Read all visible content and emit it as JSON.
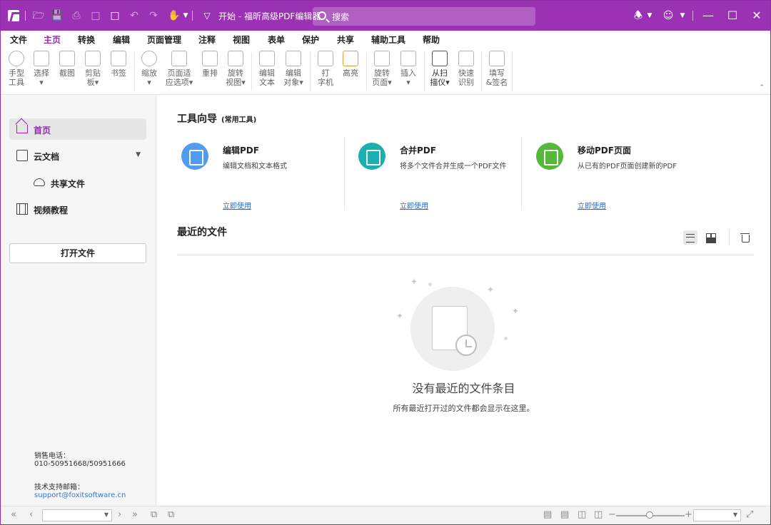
{
  "titlebar": {
    "title": "开始 - 福昕高级PDF编辑器",
    "search_placeholder": "搜索",
    "accent": "#9b32b3"
  },
  "menu": {
    "items": [
      "文件",
      "主页",
      "转换",
      "编辑",
      "页面管理",
      "注释",
      "视图",
      "表单",
      "保护",
      "共享",
      "辅助工具",
      "帮助"
    ],
    "active": "主页"
  },
  "ribbon": {
    "buttons": [
      {
        "label": "手型\n工具",
        "icon": "hand-icon"
      },
      {
        "label": "选择\n▾",
        "icon": "select-icon"
      },
      {
        "label": "截图",
        "icon": "screenshot-icon"
      },
      {
        "label": "剪贴\n板▾",
        "icon": "clipboard-icon"
      },
      {
        "label": "书签",
        "icon": "bookmark-icon"
      },
      {
        "label": "缩放\n▾",
        "icon": "zoom-icon"
      },
      {
        "label": "页面适\n应选项▾",
        "icon": "fit-page-icon"
      },
      {
        "label": "重排",
        "icon": "reflow-icon"
      },
      {
        "label": "旋转\n视图▾",
        "icon": "rotate-view-icon"
      },
      {
        "label": "编辑\n文本",
        "icon": "edit-text-icon"
      },
      {
        "label": "编辑\n对象▾",
        "icon": "edit-object-icon"
      },
      {
        "label": "打\n字机",
        "icon": "typewriter-icon"
      },
      {
        "label": "高亮",
        "icon": "highlight-icon"
      },
      {
        "label": "旋转\n页面▾",
        "icon": "rotate-page-icon"
      },
      {
        "label": "插入\n▾",
        "icon": "insert-icon"
      },
      {
        "label": "从扫\n描仪▾",
        "icon": "scanner-icon"
      },
      {
        "label": "快速\n识别",
        "icon": "ocr-icon"
      },
      {
        "label": "填写\n&签名",
        "icon": "fill-sign-icon"
      }
    ]
  },
  "sidebar": {
    "items": [
      {
        "label": "首页",
        "icon": "home-icon"
      },
      {
        "label": "云文档",
        "icon": "cloud-doc-icon"
      },
      {
        "label": "共享文件",
        "icon": "cloud-icon"
      },
      {
        "label": "视频教程",
        "icon": "film-icon"
      }
    ],
    "open_file": "打开文件",
    "sales_label": "销售电话：",
    "sales_phone": "010-50951668/50951666",
    "support_label": "技术支持邮箱：",
    "support_email": "support@foxitsoftware.cn"
  },
  "tool_guide": {
    "title": "工具向导",
    "subtitle": "(常用工具)",
    "cards": [
      {
        "title": "编辑PDF",
        "desc": "编辑文档和文本格式",
        "link": "立即使用",
        "color": "#4f9cf0",
        "icon": "edit-pdf-icon"
      },
      {
        "title": "合并PDF",
        "desc": "将多个文件合并生成一个PDF文件",
        "link": "立即使用",
        "color": "#1aafb0",
        "icon": "merge-pdf-icon"
      },
      {
        "title": "移动PDF页面",
        "desc": "从已有的PDF页面创建新的PDF",
        "link": "立即使用",
        "color": "#55b83a",
        "icon": "move-pages-icon"
      }
    ]
  },
  "recent": {
    "title": "最近的文件",
    "empty_title": "没有最近的文件条目",
    "empty_sub": "所有最近打开过的文件都会显示在这里。"
  }
}
